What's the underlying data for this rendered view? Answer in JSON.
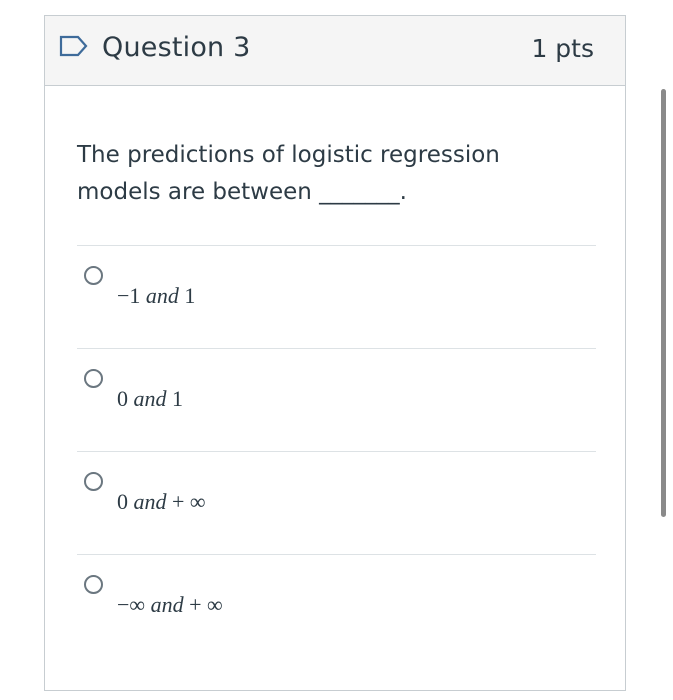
{
  "question": {
    "title": "Question 3",
    "points": "1 pts",
    "text": "The predictions of logistic regression models are between _______.",
    "flag_icon": "bookmark-flag-icon"
  },
  "answers": [
    {
      "pre": "−1 ",
      "italic": "and",
      "post": " 1"
    },
    {
      "pre": "0 ",
      "italic": "and",
      "post": " 1"
    },
    {
      "pre": "0 ",
      "italic": "and",
      "post": " + ∞"
    },
    {
      "pre": "−∞ ",
      "italic": "and",
      "post": " + ∞"
    }
  ],
  "colors": {
    "header_bg": "#f5f5f5",
    "border": "#c7cdd1",
    "text": "#2d3b45",
    "flag": "#3e6b9a"
  }
}
